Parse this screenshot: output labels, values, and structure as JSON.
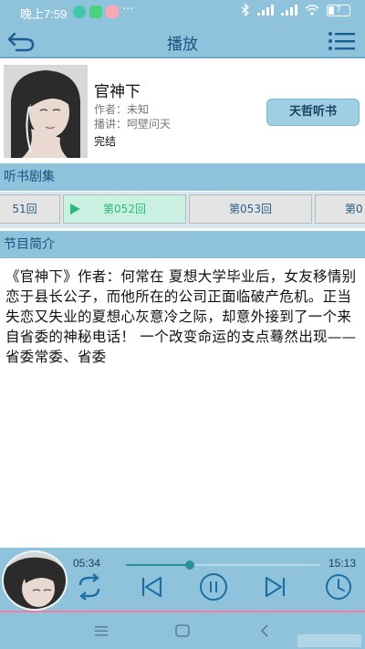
{
  "status_bar": {
    "time": "晚上7:59",
    "battery": "7"
  },
  "header": {
    "title": "播放"
  },
  "book": {
    "title": "官神下",
    "author": "作者：未知",
    "narrator": "播讲：呵壁问天",
    "status": "完结",
    "source_button": "天哲听书"
  },
  "sections": {
    "episodes_title": "听书剧集",
    "intro_title": "节目简介"
  },
  "episodes": [
    "51回",
    "第052回",
    "第053回",
    "第0"
  ],
  "description": "《官神下》作者：何常在 夏想大学毕业后，女友移情别恋于县长公子，而他所在的公司正面临破产危机。正当失恋又失业的夏想心灰意冷之际，却意外接到了一个来自省委的神秘电话！ 一个改变命运的支点蓦然出现——省委常委、省委",
  "player": {
    "current_time": "05:34",
    "total_time": "15:13",
    "progress": 0.33
  },
  "colors": {
    "accent": "#8fc3dc",
    "active_episode": "#2bb880",
    "progress": "#2a8f9d"
  }
}
